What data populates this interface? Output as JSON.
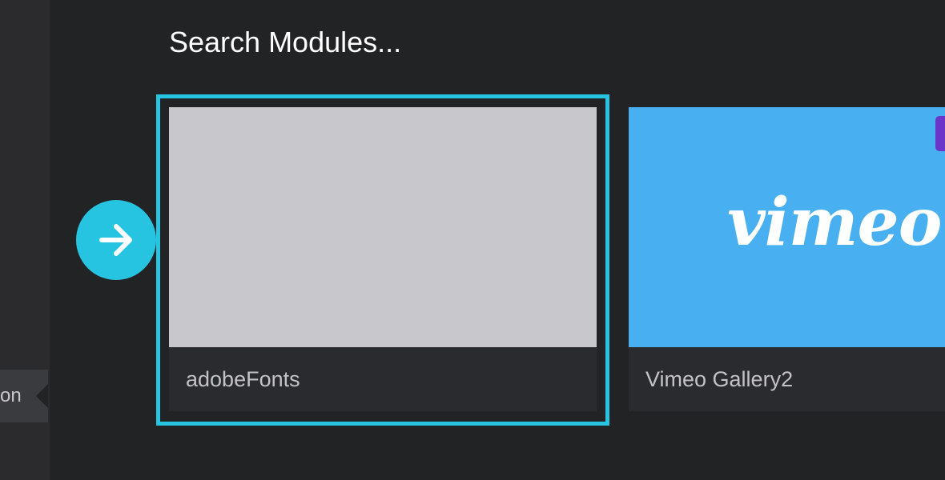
{
  "left_rail": {
    "tab_label": "on"
  },
  "header": {
    "title": "Search Modules..."
  },
  "navigation": {
    "next_icon": "arrow-right-icon",
    "accent_color": "#27c4e1"
  },
  "modules": [
    {
      "name": "adobeFonts",
      "selected": true,
      "thumbnail": "placeholder"
    },
    {
      "name": "Vimeo Gallery2",
      "selected": false,
      "thumbnail_text": "vimeo",
      "thumbnail_color": "#48b0f0"
    }
  ],
  "colors": {
    "background": "#222325",
    "card": "#2a2b2f",
    "badge": "#6a35c8"
  }
}
